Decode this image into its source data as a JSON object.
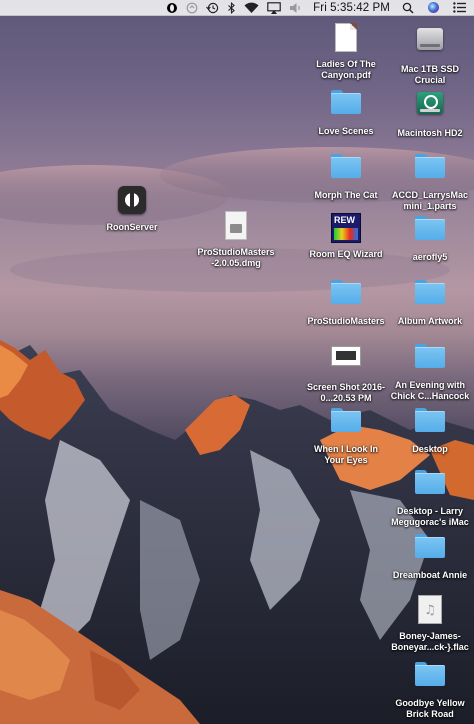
{
  "menubar": {
    "clock": "Fri 5:35:42 PM",
    "icons": [
      "app-logo-icon",
      "sync-icon",
      "time-machine-icon",
      "bluetooth-icon",
      "wifi-icon",
      "airplay-icon",
      "volume-icon",
      "spotlight-icon",
      "siri-icon",
      "notification-center-icon"
    ]
  },
  "desktop": {
    "icons": [
      {
        "label": "Ladies Of The Canyon.pdf",
        "type": "pdf"
      },
      {
        "label": "Mac 1TB SSD Crucial",
        "type": "drive"
      },
      {
        "label": "Love Scenes",
        "type": "folder"
      },
      {
        "label": "Macintosh HD2",
        "type": "timemachine-drive"
      },
      {
        "label": "Morph The Cat",
        "type": "folder"
      },
      {
        "label": "ACCD_LarrysMac mini_1.parts",
        "type": "folder"
      },
      {
        "label": "RoonServer",
        "type": "app"
      },
      {
        "label": "ProStudioMasters -2.0.05.dmg",
        "type": "dmg"
      },
      {
        "label": "Room EQ Wizard",
        "type": "app"
      },
      {
        "label": "aerofly5",
        "type": "folder"
      },
      {
        "label": "ProStudioMasters",
        "type": "folder"
      },
      {
        "label": "Album Artwork",
        "type": "folder"
      },
      {
        "label": "Screen Shot 2016-0...20.53 PM",
        "type": "screenshot"
      },
      {
        "label": "An Evening with Chick C...Hancock",
        "type": "folder"
      },
      {
        "label": "When I Look In Your Eyes",
        "type": "folder"
      },
      {
        "label": "Desktop",
        "type": "folder"
      },
      {
        "label": "Desktop - Larry Megugorac's iMac",
        "type": "folder"
      },
      {
        "label": "Dreamboat Annie",
        "type": "folder"
      },
      {
        "label": "Boney-James-Boneyar...ck-}.flac",
        "type": "audio"
      },
      {
        "label": "Goodbye Yellow Brick Road",
        "type": "folder"
      }
    ]
  }
}
